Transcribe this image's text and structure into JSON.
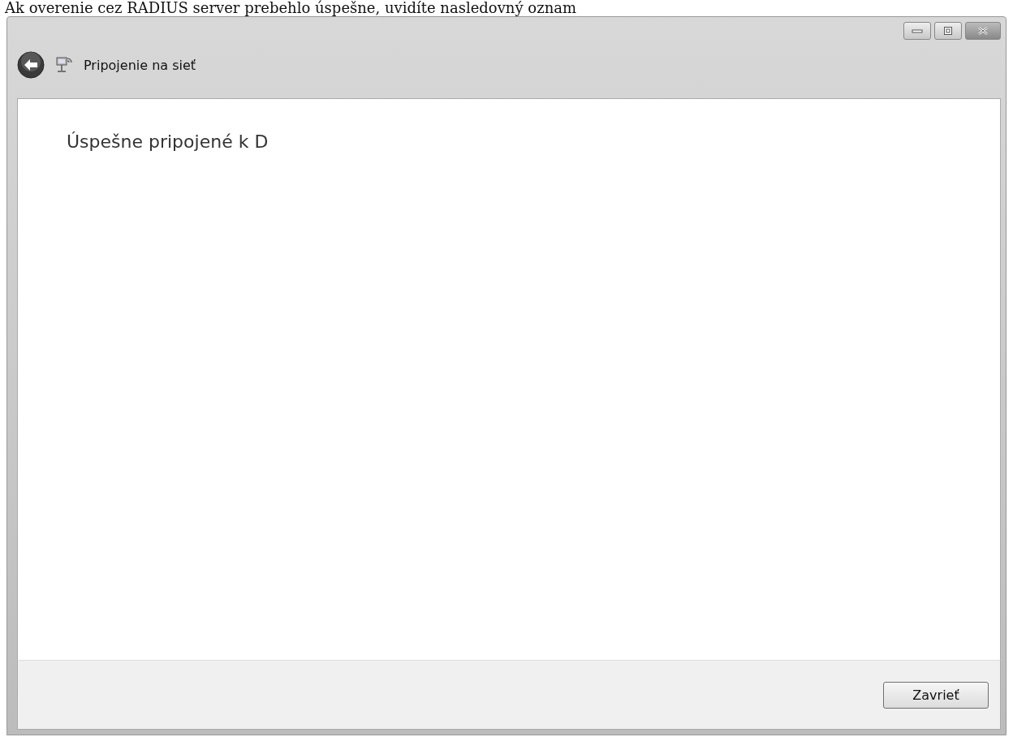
{
  "caption": "Ak overenie cez RADIUS server prebehlo úspešne, uvidíte nasledovný oznam",
  "window": {
    "title": "Pripojenie na sieť"
  },
  "message": "Úspešne pripojené k D",
  "buttons": [
    "Zavrieť"
  ]
}
